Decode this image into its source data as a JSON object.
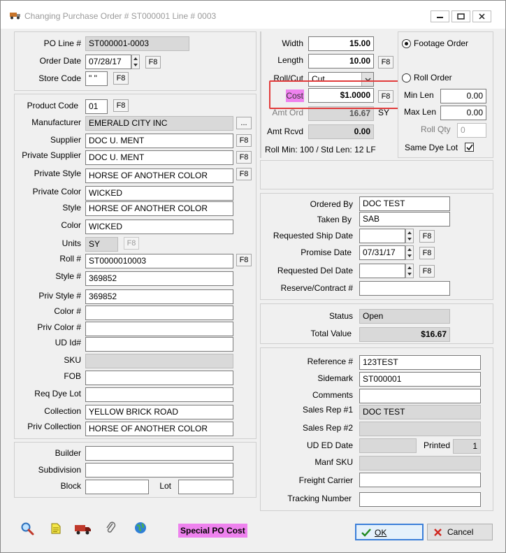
{
  "window": {
    "title": "Changing Purchase Order # ST000001  Line # 0003"
  },
  "header": {
    "po_line_label": "PO Line #",
    "po_line_value": "ST000001-0003",
    "order_date_label": "Order Date",
    "order_date_value": "07/28/17",
    "store_code_label": "Store Code",
    "store_code_value": "\" \"",
    "f8": "F8"
  },
  "product": {
    "product_code_label": "Product Code",
    "product_code_value": "01",
    "manufacturer_label": "Manufacturer",
    "manufacturer_value": "EMERALD CITY INC",
    "ellipsis": "...",
    "supplier_label": "Supplier",
    "supplier_value": "DOC U. MENT",
    "private_supplier_label": "Private Supplier",
    "private_supplier_value": "DOC U. MENT",
    "private_style_label": "Private Style",
    "private_style_value": "HORSE OF ANOTHER COLOR",
    "private_color_label": "Private Color",
    "private_color_value": "WICKED",
    "style_label": "Style",
    "style_value": "HORSE OF ANOTHER COLOR",
    "color_label": "Color",
    "color_value": "WICKED",
    "units_label": "Units",
    "units_value": "SY",
    "roll_label": "Roll #",
    "roll_value": "ST0000010003",
    "style_num_label": "Style #",
    "style_num_value": "369852",
    "priv_style_num_label": "Priv Style #",
    "priv_style_num_value": "369852",
    "color_num_label": "Color #",
    "color_num_value": "",
    "priv_color_num_label": "Priv Color #",
    "priv_color_num_value": "",
    "ud_id_label": "UD Id#",
    "ud_id_value": "",
    "sku_label": "SKU",
    "sku_value": "",
    "fob_label": "FOB",
    "fob_value": "",
    "req_dye_lot_label": "Req Dye Lot",
    "req_dye_lot_value": "",
    "collection_label": "Collection",
    "collection_value": "YELLOW BRICK ROAD",
    "priv_collection_label": "Priv Collection",
    "priv_collection_value": "HORSE OF ANOTHER COLOR"
  },
  "builder": {
    "builder_label": "Builder",
    "builder_value": "",
    "subdivision_label": "Subdivision",
    "subdivision_value": "",
    "block_label": "Block",
    "block_value": "",
    "lot_label": "Lot",
    "lot_value": ""
  },
  "measure": {
    "width_label": "Width",
    "width_value": "15.00",
    "length_label": "Length",
    "length_value": "10.00",
    "rollcut_label": "Roll/Cut",
    "rollcut_value": "Cut",
    "cost_label": "Cost",
    "cost_value": "$1.0000",
    "amt_ord_label": "Amt Ord",
    "amt_ord_value": "16.67",
    "amt_ord_unit": "SY",
    "amt_rcvd_label": "Amt Rcvd",
    "amt_rcvd_value": "0.00",
    "roll_info": "Roll Min: 100 / Std Len: 12 LF",
    "highlight_color": "#e23c3c",
    "cost_label_bg": "#ee82ee"
  },
  "order_type": {
    "footage_order": "Footage Order",
    "roll_order": "Roll Order",
    "min_len_label": "Min Len",
    "min_len_value": "0.00",
    "max_len_label": "Max Len",
    "max_len_value": "0.00",
    "roll_qty_label": "Roll Qty",
    "roll_qty_value": "0",
    "same_dye_lot_label": "Same Dye Lot"
  },
  "ordering": {
    "ordered_by_label": "Ordered By",
    "ordered_by_value": "DOC TEST",
    "taken_by_label": "Taken By",
    "taken_by_value": "SAB",
    "req_ship_date_label": "Requested Ship Date",
    "req_ship_date_value": "",
    "promise_date_label": "Promise Date",
    "promise_date_value": "07/31/17",
    "req_del_date_label": "Requested Del Date",
    "req_del_date_value": "",
    "reserve_contract_label": "Reserve/Contract #",
    "reserve_contract_value": ""
  },
  "status": {
    "status_label": "Status",
    "status_value": "Open",
    "total_value_label": "Total Value",
    "total_value_value": "$16.67"
  },
  "reference": {
    "reference_label": "Reference #",
    "reference_value": "123TEST",
    "sidemark_label": "Sidemark",
    "sidemark_value": "ST000001",
    "comments_label": "Comments",
    "comments_value": "",
    "sales_rep1_label": "Sales Rep #1",
    "sales_rep1_value": "DOC TEST",
    "sales_rep2_label": "Sales Rep #2",
    "sales_rep2_value": "",
    "ud_ed_date_label": "UD ED Date",
    "ud_ed_date_value": "",
    "printed_label": "Printed",
    "printed_value": "1",
    "manf_sku_label": "Manf SKU",
    "manf_sku_value": "",
    "freight_carrier_label": "Freight Carrier",
    "freight_carrier_value": "",
    "tracking_number_label": "Tracking Number",
    "tracking_number_value": ""
  },
  "footer": {
    "special_po_cost": "Special PO Cost",
    "special_po_cost_bg": "#ee82ee",
    "ok_label": "OK",
    "cancel_label": "Cancel",
    "icons": [
      "magnifier-icon",
      "note-icon",
      "truck-icon",
      "paperclip-icon",
      "globe-icon"
    ]
  }
}
